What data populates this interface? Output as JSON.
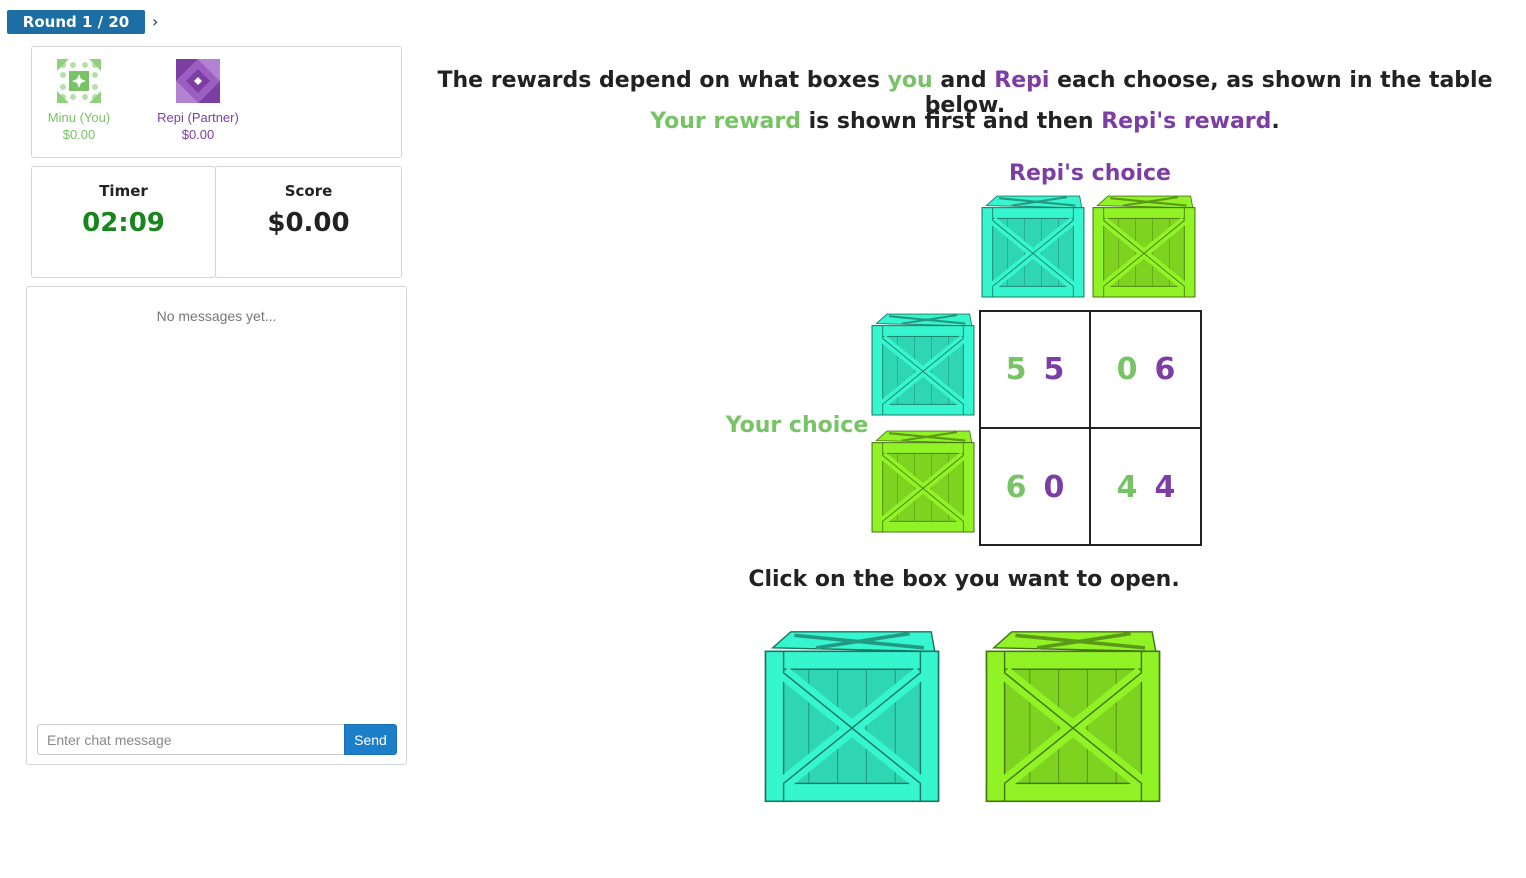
{
  "round": {
    "label": "Round 1 / 20",
    "next_icon": "chevron-right-icon"
  },
  "players": [
    {
      "name": "Minu (You)",
      "score": "$0.00",
      "color": "#77c365",
      "avatar_icon": "green-pattern-avatar-icon"
    },
    {
      "name": "Repi (Partner)",
      "score": "$0.00",
      "color": "#7d3ea4",
      "avatar_icon": "purple-diamond-avatar-icon"
    }
  ],
  "timer": {
    "label": "Timer",
    "value": "02:09",
    "color": "#19851f"
  },
  "score": {
    "label": "Score",
    "value": "$0.00"
  },
  "chat": {
    "empty_text": "No messages yet...",
    "placeholder": "Enter chat message",
    "send_label": "Send"
  },
  "instructions": {
    "line1": {
      "a": "The rewards depend on what boxes ",
      "you": "you",
      "b": " and ",
      "repi": "Repi",
      "c": " each choose, as shown in the table below."
    },
    "line2": {
      "your_reward": "Your reward",
      "b": " is shown first and then ",
      "repi_reward": "Repi's reward",
      "c": "."
    }
  },
  "repi_choice_label": "Repi's choice",
  "your_choice_label": "Your choice",
  "payoff": {
    "rows": [
      [
        {
          "you": "5",
          "repi": "5"
        },
        {
          "you": "0",
          "repi": "6"
        }
      ],
      [
        {
          "you": "6",
          "repi": "0"
        },
        {
          "you": "4",
          "repi": "4"
        }
      ]
    ]
  },
  "boxes": [
    {
      "name": "teal crate",
      "color": "#2fd6b4"
    },
    {
      "name": "green crate",
      "color": "#7ed321"
    }
  ],
  "click_instruction": "Click on the box you want to open."
}
